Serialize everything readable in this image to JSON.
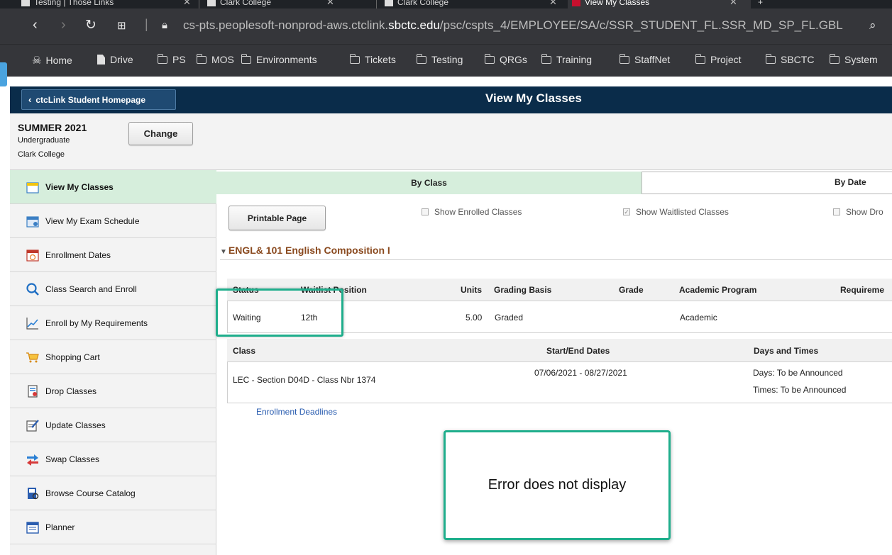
{
  "browser": {
    "tabs": [
      {
        "label": "Testing | Those Links",
        "active": false
      },
      {
        "label": "Clark College",
        "active": false
      },
      {
        "label": "Clark College",
        "active": false
      },
      {
        "label": "View My Classes",
        "active": true
      }
    ],
    "url_prefix": "cs-pts.peoplesoft-nonprod-aws.ctclink.",
    "url_domain": "sbctc.edu",
    "url_path": "/psc/cspts_4/EMPLOYEE/SA/c/SSR_STUDENT_FL.SSR_MD_SP_FL.GBL",
    "bookmarks": [
      "Home",
      "Drive",
      "PS",
      "MOS",
      "Environments",
      "Tickets",
      "Testing",
      "QRGs",
      "Training",
      "StaffNet",
      "Project",
      "SBCTC",
      "System"
    ]
  },
  "header": {
    "home_button": "ctcLink Student Homepage",
    "page_title": "View My Classes"
  },
  "term": {
    "name": "SUMMER 2021",
    "career": "Undergraduate",
    "institution": "Clark College",
    "change_label": "Change"
  },
  "sidebar": {
    "items": [
      {
        "label": "View My Classes",
        "icon": "calendar-icon"
      },
      {
        "label": "View My Exam Schedule",
        "icon": "exam-calendar-icon"
      },
      {
        "label": "Enrollment Dates",
        "icon": "clock-calendar-icon"
      },
      {
        "label": "Class Search and Enroll",
        "icon": "search-icon"
      },
      {
        "label": "Enroll by My Requirements",
        "icon": "chart-line-icon"
      },
      {
        "label": "Shopping Cart",
        "icon": "cart-icon"
      },
      {
        "label": "Drop Classes",
        "icon": "drop-list-icon"
      },
      {
        "label": "Update Classes",
        "icon": "edit-icon"
      },
      {
        "label": "Swap Classes",
        "icon": "swap-icon"
      },
      {
        "label": "Browse Course Catalog",
        "icon": "catalog-icon"
      },
      {
        "label": "Planner",
        "icon": "planner-icon"
      }
    ]
  },
  "main": {
    "tabs": {
      "by_class": "By Class",
      "by_date": "By Date"
    },
    "printable_label": "Printable Page",
    "filters": {
      "enrolled": "Show Enrolled Classes",
      "waitlisted": "Show Waitlisted Classes",
      "dropped": "Show Dro"
    },
    "course_title": "ENGL& 101 English Composition I",
    "status_grid": {
      "headers": {
        "status": "Status",
        "waitlist": "Waitlist Position",
        "units": "Units",
        "grading": "Grading Basis",
        "grade": "Grade",
        "program": "Academic Program",
        "requirement": "Requireme"
      },
      "row": {
        "status": "Waiting",
        "waitlist": "12th",
        "units": "5.00",
        "grading": "Graded",
        "grade": "",
        "program": "Academic"
      }
    },
    "class_grid": {
      "headers": {
        "class": "Class",
        "dates": "Start/End Dates",
        "days_times": "Days and Times"
      },
      "row": {
        "class": "LEC - Section D04D - Class Nbr 1374",
        "dates": "07/06/2021 - 08/27/2021",
        "days": "Days: To be Announced",
        "times": "Times: To be Announced"
      }
    },
    "deadlines_link": "Enrollment Deadlines"
  },
  "annotation": {
    "callout_text": "Error does not display",
    "accent_color": "#1fae8c"
  }
}
